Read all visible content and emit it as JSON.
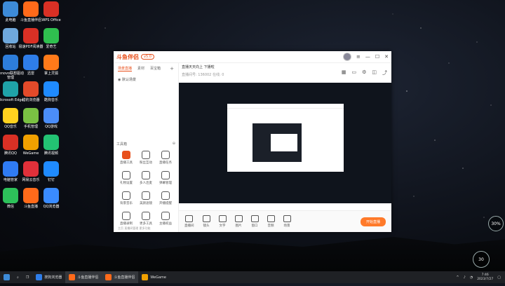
{
  "desktop": {
    "icons": [
      {
        "label": "此电脑",
        "color": "#3d8bd8"
      },
      {
        "label": "斗鱼直播伴侣",
        "color": "#ff6a1a"
      },
      {
        "label": "WPS Office",
        "color": "#d93025"
      },
      {
        "label": "回收站",
        "color": "#6fa8dc"
      },
      {
        "label": "极速PDF阅读器",
        "color": "#d93025"
      },
      {
        "label": "爱奇艺",
        "color": "#2fbf4f"
      },
      {
        "label": "Lenovo联想驱动管理",
        "color": "#2d7ddb"
      },
      {
        "label": "迅雷",
        "color": "#2e7de9"
      },
      {
        "label": "掌上灵狐",
        "color": "#ff7a1a"
      },
      {
        "label": "Microsoft Edge",
        "color": "#1fa2a8"
      },
      {
        "label": "猎豹浏览器",
        "color": "#e34a2a"
      },
      {
        "label": "酷狗音乐",
        "color": "#1f8bff"
      },
      {
        "label": "QQ音乐",
        "color": "#ffd21f"
      },
      {
        "label": "手机管理",
        "color": "#7ac143"
      },
      {
        "label": "QQ游戏",
        "color": "#4b8df8"
      },
      {
        "label": "腾讯QQ",
        "color": "#d93025"
      },
      {
        "label": "WeGame",
        "color": "#f0a000"
      },
      {
        "label": "腾讯视频",
        "color": "#23c273"
      },
      {
        "label": "电脑管家",
        "color": "#2f7bf3"
      },
      {
        "label": "网易云音乐",
        "color": "#e0303a"
      },
      {
        "label": "钉钉",
        "color": "#1f8bff"
      },
      {
        "label": "微信",
        "color": "#2dc15a"
      },
      {
        "label": "斗鱼直播",
        "color": "#ff6a1a"
      },
      {
        "label": "QQ浏览器",
        "color": "#3a8bff"
      }
    ]
  },
  "window": {
    "app_name": "斗鱼伴侣",
    "version_badge": "v5.0",
    "left_tabs": [
      "场景直播",
      "素材",
      "百宝箱"
    ],
    "scene_label": "默认场景",
    "tools_title": "工具箱",
    "tools": [
      {
        "label": "直播工具",
        "hot": true
      },
      {
        "label": "粉丝互动",
        "hot": false
      },
      {
        "label": "直播任务",
        "hot": false
      },
      {
        "label": "礼物设置",
        "hot": false
      },
      {
        "label": "多人连麦",
        "hot": false
      },
      {
        "label": "弹幕管理",
        "hot": false
      },
      {
        "label": "背景音乐",
        "hot": false
      },
      {
        "label": "美颜滤镜",
        "hot": false
      },
      {
        "label": "开播提醒",
        "hot": false
      },
      {
        "label": "直播录制",
        "hot": false
      },
      {
        "label": "更多工具",
        "hot": false
      },
      {
        "label": "主播权益",
        "hot": false
      }
    ],
    "left_footer": "主页 直播间管理 更多功能",
    "info_line": "直播天天向上 下播啦",
    "info_sub": "直播间号: 136002  在线: 0",
    "bottom_buttons": [
      "直播间",
      "镜头",
      "文字",
      "图片",
      "窗口",
      "音频",
      "场景"
    ],
    "start_button": "开始直播"
  },
  "taskbar": {
    "items": [
      {
        "label": "搜狗浏览器",
        "color": "#2e7de9",
        "active": false
      },
      {
        "label": "斗鱼直播伴侣",
        "color": "#ff6a1a",
        "active": true
      },
      {
        "label": "斗鱼直播伴侣",
        "color": "#ff6a1a",
        "active": true
      },
      {
        "label": "WeGame",
        "color": "#f0a000",
        "active": false
      }
    ],
    "time": "7:46",
    "date": "2023/7/27"
  },
  "widgets": {
    "net_speed": "30%",
    "cpu_temp": "30"
  }
}
